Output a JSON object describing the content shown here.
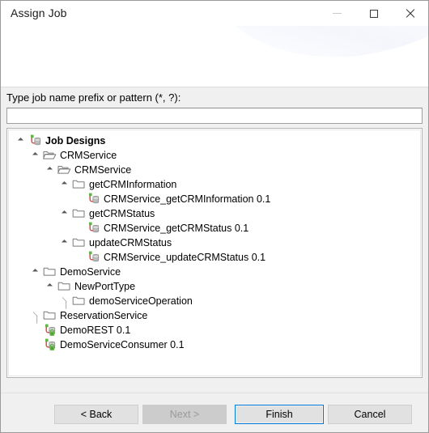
{
  "window": {
    "title": "Assign Job",
    "caption_buttons": [
      {
        "name": "minimize-button",
        "glyph": "minimize-icon",
        "label": "Minimize"
      },
      {
        "name": "maximize-button",
        "glyph": "maximize-icon",
        "label": "Maximize"
      },
      {
        "name": "close-button",
        "glyph": "close-icon",
        "label": "Close"
      }
    ]
  },
  "filter": {
    "label": "Type job name prefix or pattern (*, ?):",
    "value": "",
    "placeholder": ""
  },
  "tree": {
    "rows": [
      {
        "label": "Job Designs",
        "depth": 0,
        "state": "expanded",
        "icon": "job-designs-icon",
        "bold": true
      },
      {
        "label": "CRMService",
        "depth": 1,
        "state": "expanded",
        "icon": "open-folder-icon",
        "bold": false
      },
      {
        "label": "CRMService",
        "depth": 2,
        "state": "expanded",
        "icon": "open-folder-icon",
        "bold": false
      },
      {
        "label": "getCRMInformation",
        "depth": 3,
        "state": "expanded",
        "icon": "folder-icon",
        "bold": false
      },
      {
        "label": "CRMService_getCRMInformation 0.1",
        "depth": 4,
        "state": "leaf",
        "icon": "job-icon",
        "bold": false
      },
      {
        "label": "getCRMStatus",
        "depth": 3,
        "state": "expanded",
        "icon": "folder-icon",
        "bold": false
      },
      {
        "label": "CRMService_getCRMStatus 0.1",
        "depth": 4,
        "state": "leaf",
        "icon": "job-icon",
        "bold": false
      },
      {
        "label": "updateCRMStatus",
        "depth": 3,
        "state": "expanded",
        "icon": "folder-icon",
        "bold": false
      },
      {
        "label": "CRMService_updateCRMStatus 0.1",
        "depth": 4,
        "state": "leaf",
        "icon": "job-icon",
        "bold": false
      },
      {
        "label": "DemoService",
        "depth": 1,
        "state": "expanded",
        "icon": "folder-icon",
        "bold": false
      },
      {
        "label": "NewPortType",
        "depth": 2,
        "state": "expanded",
        "icon": "folder-icon",
        "bold": false
      },
      {
        "label": "demoServiceOperation",
        "depth": 3,
        "state": "collapsed",
        "icon": "folder-icon",
        "bold": false
      },
      {
        "label": "ReservationService",
        "depth": 1,
        "state": "collapsed",
        "icon": "folder-icon",
        "bold": false
      },
      {
        "label": "DemoREST 0.1",
        "depth": 1,
        "state": "leaf",
        "icon": "job-locked-icon",
        "bold": false
      },
      {
        "label": "DemoServiceConsumer 0.1",
        "depth": 1,
        "state": "leaf",
        "icon": "job-locked-icon",
        "bold": false
      }
    ]
  },
  "footer": {
    "buttons": [
      {
        "name": "back-button",
        "label": "< Back",
        "enabled": true,
        "default": false
      },
      {
        "name": "next-button",
        "label": "Next >",
        "enabled": false,
        "default": false
      },
      {
        "name": "finish-button",
        "label": "Finish",
        "enabled": true,
        "default": true
      },
      {
        "name": "cancel-button",
        "label": "Cancel",
        "enabled": true,
        "default": false
      }
    ]
  },
  "colors": {
    "accent": "#0078d7",
    "icon_green": "#5eb545",
    "icon_red": "#d1443c",
    "icon_gray": "#8a8a8a",
    "folder_outline": "#7a7a7a",
    "body_background": "#f0f0f0"
  }
}
